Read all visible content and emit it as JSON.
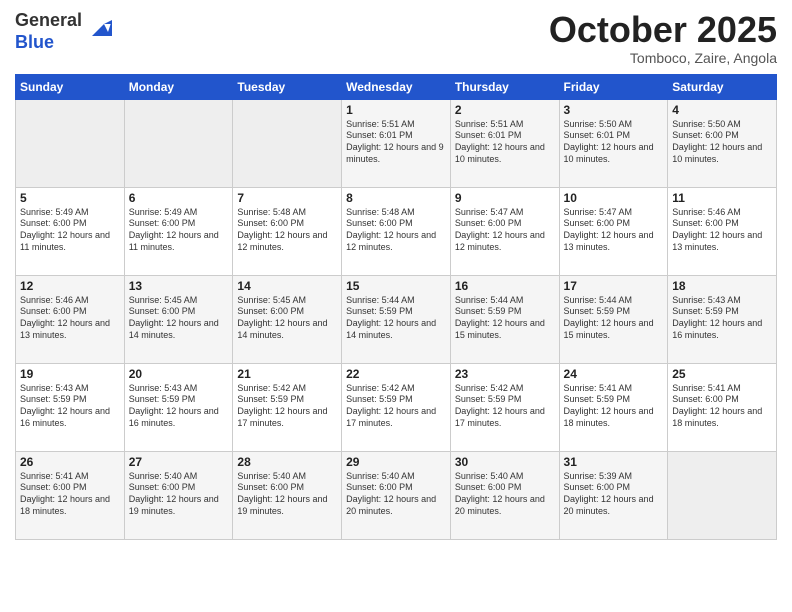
{
  "header": {
    "logo_general": "General",
    "logo_blue": "Blue",
    "month_title": "October 2025",
    "location": "Tomboco, Zaire, Angola"
  },
  "days_of_week": [
    "Sunday",
    "Monday",
    "Tuesday",
    "Wednesday",
    "Thursday",
    "Friday",
    "Saturday"
  ],
  "weeks": [
    [
      {
        "day": "",
        "content": ""
      },
      {
        "day": "",
        "content": ""
      },
      {
        "day": "",
        "content": ""
      },
      {
        "day": "1",
        "content": "Sunrise: 5:51 AM\nSunset: 6:01 PM\nDaylight: 12 hours and 9 minutes."
      },
      {
        "day": "2",
        "content": "Sunrise: 5:51 AM\nSunset: 6:01 PM\nDaylight: 12 hours and 10 minutes."
      },
      {
        "day": "3",
        "content": "Sunrise: 5:50 AM\nSunset: 6:01 PM\nDaylight: 12 hours and 10 minutes."
      },
      {
        "day": "4",
        "content": "Sunrise: 5:50 AM\nSunset: 6:00 PM\nDaylight: 12 hours and 10 minutes."
      }
    ],
    [
      {
        "day": "5",
        "content": "Sunrise: 5:49 AM\nSunset: 6:00 PM\nDaylight: 12 hours and 11 minutes."
      },
      {
        "day": "6",
        "content": "Sunrise: 5:49 AM\nSunset: 6:00 PM\nDaylight: 12 hours and 11 minutes."
      },
      {
        "day": "7",
        "content": "Sunrise: 5:48 AM\nSunset: 6:00 PM\nDaylight: 12 hours and 12 minutes."
      },
      {
        "day": "8",
        "content": "Sunrise: 5:48 AM\nSunset: 6:00 PM\nDaylight: 12 hours and 12 minutes."
      },
      {
        "day": "9",
        "content": "Sunrise: 5:47 AM\nSunset: 6:00 PM\nDaylight: 12 hours and 12 minutes."
      },
      {
        "day": "10",
        "content": "Sunrise: 5:47 AM\nSunset: 6:00 PM\nDaylight: 12 hours and 13 minutes."
      },
      {
        "day": "11",
        "content": "Sunrise: 5:46 AM\nSunset: 6:00 PM\nDaylight: 12 hours and 13 minutes."
      }
    ],
    [
      {
        "day": "12",
        "content": "Sunrise: 5:46 AM\nSunset: 6:00 PM\nDaylight: 12 hours and 13 minutes."
      },
      {
        "day": "13",
        "content": "Sunrise: 5:45 AM\nSunset: 6:00 PM\nDaylight: 12 hours and 14 minutes."
      },
      {
        "day": "14",
        "content": "Sunrise: 5:45 AM\nSunset: 6:00 PM\nDaylight: 12 hours and 14 minutes."
      },
      {
        "day": "15",
        "content": "Sunrise: 5:44 AM\nSunset: 5:59 PM\nDaylight: 12 hours and 14 minutes."
      },
      {
        "day": "16",
        "content": "Sunrise: 5:44 AM\nSunset: 5:59 PM\nDaylight: 12 hours and 15 minutes."
      },
      {
        "day": "17",
        "content": "Sunrise: 5:44 AM\nSunset: 5:59 PM\nDaylight: 12 hours and 15 minutes."
      },
      {
        "day": "18",
        "content": "Sunrise: 5:43 AM\nSunset: 5:59 PM\nDaylight: 12 hours and 16 minutes."
      }
    ],
    [
      {
        "day": "19",
        "content": "Sunrise: 5:43 AM\nSunset: 5:59 PM\nDaylight: 12 hours and 16 minutes."
      },
      {
        "day": "20",
        "content": "Sunrise: 5:43 AM\nSunset: 5:59 PM\nDaylight: 12 hours and 16 minutes."
      },
      {
        "day": "21",
        "content": "Sunrise: 5:42 AM\nSunset: 5:59 PM\nDaylight: 12 hours and 17 minutes."
      },
      {
        "day": "22",
        "content": "Sunrise: 5:42 AM\nSunset: 5:59 PM\nDaylight: 12 hours and 17 minutes."
      },
      {
        "day": "23",
        "content": "Sunrise: 5:42 AM\nSunset: 5:59 PM\nDaylight: 12 hours and 17 minutes."
      },
      {
        "day": "24",
        "content": "Sunrise: 5:41 AM\nSunset: 5:59 PM\nDaylight: 12 hours and 18 minutes."
      },
      {
        "day": "25",
        "content": "Sunrise: 5:41 AM\nSunset: 6:00 PM\nDaylight: 12 hours and 18 minutes."
      }
    ],
    [
      {
        "day": "26",
        "content": "Sunrise: 5:41 AM\nSunset: 6:00 PM\nDaylight: 12 hours and 18 minutes."
      },
      {
        "day": "27",
        "content": "Sunrise: 5:40 AM\nSunset: 6:00 PM\nDaylight: 12 hours and 19 minutes."
      },
      {
        "day": "28",
        "content": "Sunrise: 5:40 AM\nSunset: 6:00 PM\nDaylight: 12 hours and 19 minutes."
      },
      {
        "day": "29",
        "content": "Sunrise: 5:40 AM\nSunset: 6:00 PM\nDaylight: 12 hours and 20 minutes."
      },
      {
        "day": "30",
        "content": "Sunrise: 5:40 AM\nSunset: 6:00 PM\nDaylight: 12 hours and 20 minutes."
      },
      {
        "day": "31",
        "content": "Sunrise: 5:39 AM\nSunset: 6:00 PM\nDaylight: 12 hours and 20 minutes."
      },
      {
        "day": "",
        "content": ""
      }
    ]
  ]
}
